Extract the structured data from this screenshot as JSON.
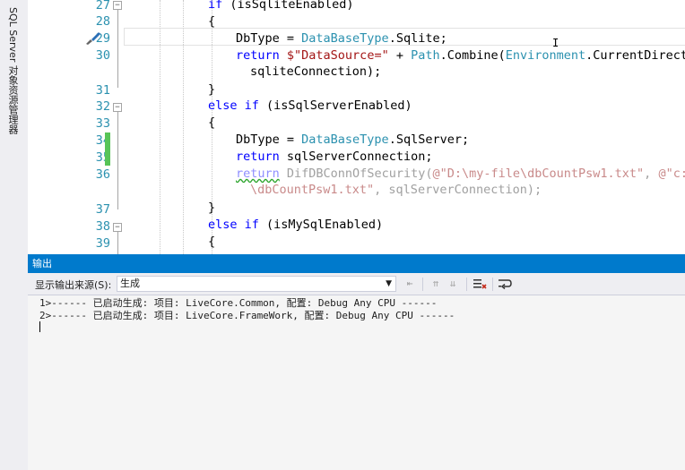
{
  "side_tab": {
    "label": "SQL Server 对象资源管理器"
  },
  "editor": {
    "line_numbers": [
      "27",
      "28",
      "29",
      "30",
      "31",
      "32",
      "33",
      "34",
      "35",
      "36",
      "37",
      "38",
      "39"
    ],
    "code": {
      "l27": {
        "kw": "if",
        "rest": " (isSqliteEnabled)"
      },
      "l28": "{",
      "l29": {
        "a": "DbType = ",
        "type": "DataBaseType",
        "b": ".Sqlite;"
      },
      "l30": {
        "kw": "return",
        "s": " $\"DataSource=\"",
        "p": " + ",
        "t1": "Path",
        "c1": ".Combine(",
        "t2": "Environment",
        "c2": ".CurrentDirectory"
      },
      "l30b": "sqliteConnection);",
      "l31": "}",
      "l32": {
        "kw": "else if",
        "rest": " (isSqlServerEnabled)"
      },
      "l33": "{",
      "l34": {
        "a": "DbType = ",
        "type": "DataBaseType",
        "b": ".SqlServer;"
      },
      "l35": {
        "kw": "return",
        "rest": " sqlServerConnection;"
      },
      "l36": {
        "kw": "return",
        "fn": " DifDBConnOfSecurity(",
        "s1": "@\"D:\\my-file\\dbCountPsw1.txt\"",
        "c": ", ",
        "s2": "@\"c:\\my"
      },
      "l36b": {
        "s": "\\dbCountPsw1.txt\"",
        "rest": ", sqlServerConnection);"
      },
      "l37": "}",
      "l38": {
        "kw": "else if",
        "rest": " (isMySqlEnabled)"
      },
      "l39": "{"
    }
  },
  "output": {
    "title": "输出",
    "source_label": "显示输出来源(S):",
    "source_value": "生成",
    "lines": [
      "1>------ 已启动生成: 项目: LiveCore.Common, 配置: Debug Any CPU ------",
      "2>------ 已启动生成: 项目: LiveCore.FrameWork, 配置: Debug Any CPU ------"
    ]
  },
  "colors": {
    "accent": "#007acc",
    "keyword": "#0000ff",
    "type": "#2b91af",
    "string": "#a31515",
    "change_bar": "#57c457"
  }
}
